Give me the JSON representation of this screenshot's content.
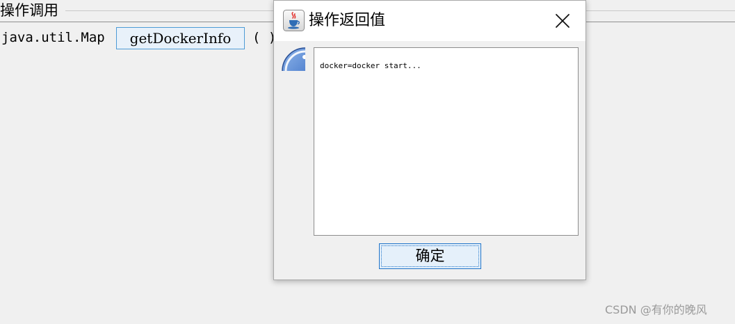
{
  "panel": {
    "section_title": "操作调用",
    "return_type": "java.util.Map",
    "method_name": "getDockerInfo",
    "params": "( )"
  },
  "dialog": {
    "title": "操作返回值",
    "title_icon": "java-coffee-cup-icon",
    "close_icon": "close-icon",
    "info_icon": "information-icon",
    "result_text": "docker=docker start...",
    "ok_label": "确定"
  },
  "watermark": "CSDN @有你的晚风",
  "colors": {
    "method_button_border": "#4d9bd6",
    "method_button_bg": "#e8f1fa",
    "ok_button_border": "#1e73c8",
    "ok_button_bg": "#e5f0fa",
    "window_bg": "#f0f0f0"
  }
}
